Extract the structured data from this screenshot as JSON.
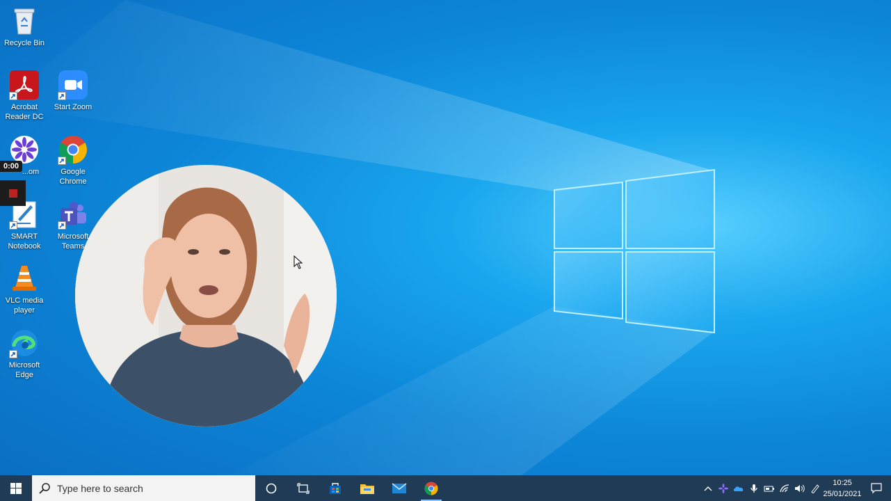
{
  "desktop": {
    "icons": [
      {
        "label": "Recycle Bin"
      },
      {
        "label": "Acrobat Reader DC"
      },
      {
        "label": "Start Zoom"
      },
      {
        "label": "...om"
      },
      {
        "label": "Google Chrome"
      },
      {
        "label": "SMART Notebook"
      },
      {
        "label": "Microsoft Teams"
      },
      {
        "label": "VLC media player"
      },
      {
        "label": "Microsoft Edge"
      }
    ]
  },
  "recorder": {
    "time": "0:00"
  },
  "taskbar": {
    "search_placeholder": "Type here to search",
    "clock_time": "10:25",
    "clock_date": "25/01/2021"
  },
  "colors": {
    "taskbar": "#1f3b55",
    "desktop_blue": "#0d86d8"
  }
}
